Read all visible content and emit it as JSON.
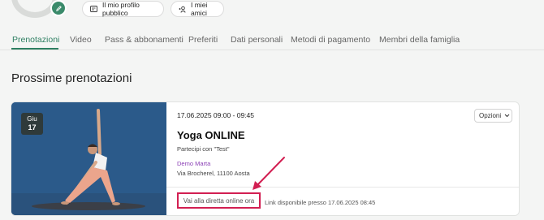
{
  "header": {
    "pills": [
      {
        "label": "Il mio profilo pubblico",
        "icon": "id-card-icon"
      },
      {
        "label": "I miei amici",
        "icon": "add-person-icon"
      }
    ]
  },
  "tabs": [
    {
      "label": "Prenotazioni",
      "active": true
    },
    {
      "label": "Video",
      "active": false
    },
    {
      "label": "Pass & abbonamenti",
      "active": false
    },
    {
      "label": "Preferiti",
      "active": false
    },
    {
      "label": "Dati personali",
      "active": false
    },
    {
      "label": "Metodi di pagamento",
      "active": false
    },
    {
      "label": "Membri della famiglia",
      "active": false
    }
  ],
  "section": {
    "title": "Prossime prenotazioni"
  },
  "booking": {
    "date_badge": {
      "month": "Giu",
      "day": "17"
    },
    "datetime": "17.06.2025 09:00 - 09:45",
    "title": "Yoga ONLINE",
    "subtitle": "Partecipi con \"Test\"",
    "instructor": "Demo Marta",
    "address": "Via Brocherel, 11100 Aosta",
    "options_label": "Opzioni",
    "live_button": "Vai alla diretta online ora",
    "link_note": "Link disponibile presso 17.06.2025 08:45"
  },
  "colors": {
    "accent": "#2e7f62",
    "highlight": "#d21f52",
    "instructor": "#8a3fb5"
  }
}
